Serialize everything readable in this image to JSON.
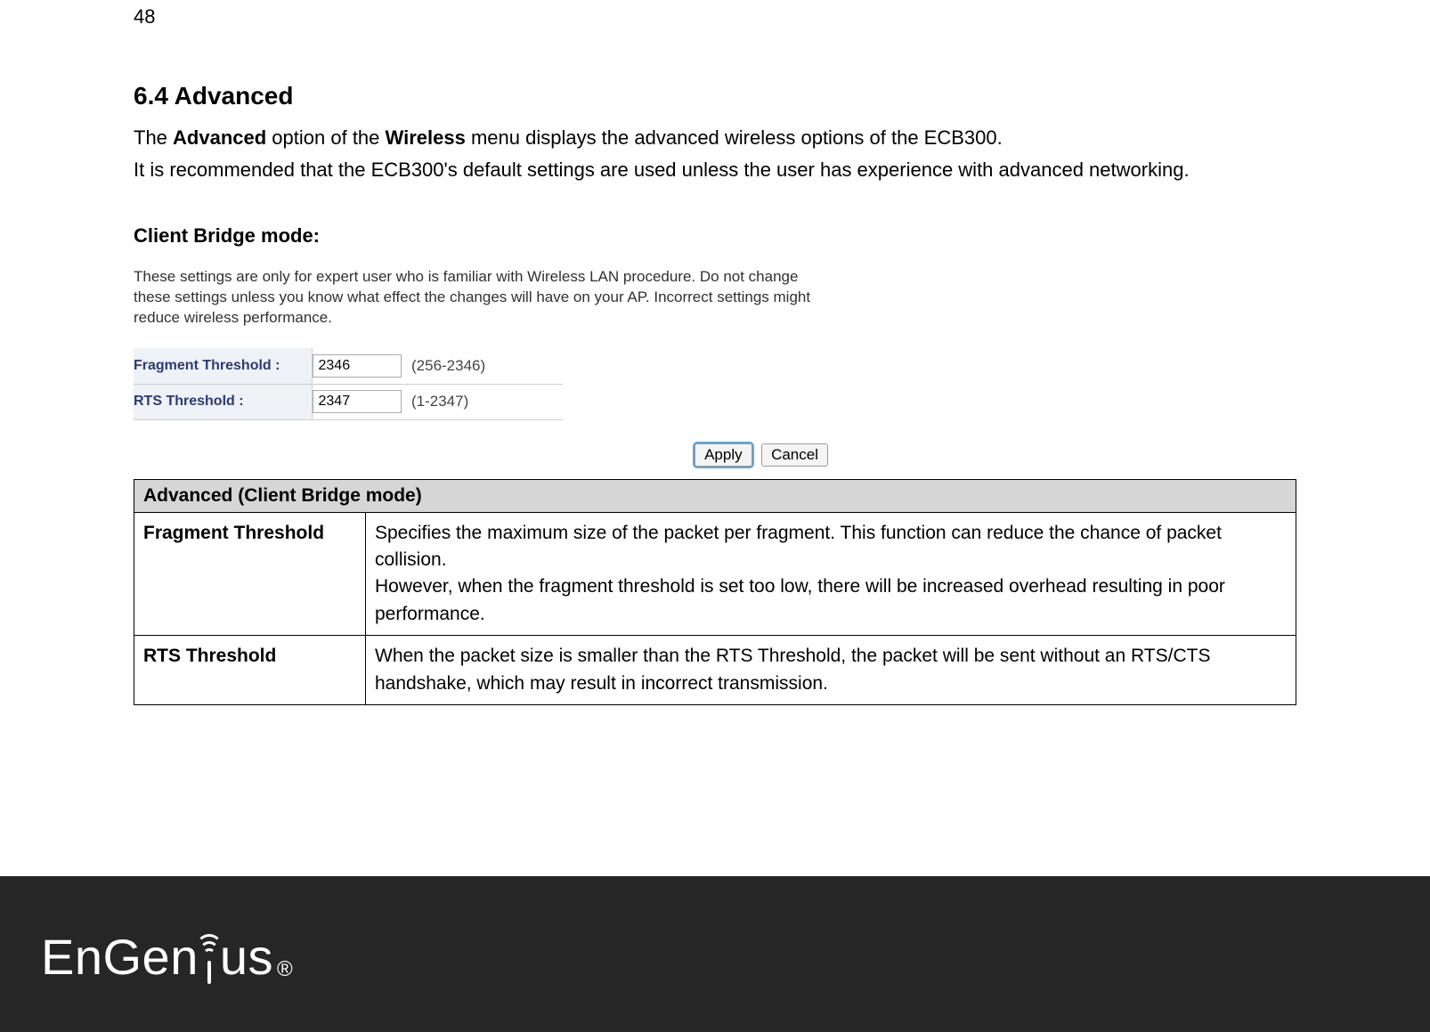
{
  "page_number": "48",
  "heading": "6.4   Advanced",
  "intro": {
    "line1_pre": "The ",
    "line1_bold1": "Advanced",
    "line1_mid": " option of the ",
    "line1_bold2": "Wireless",
    "line1_post": " menu displays the advanced wireless options of the ECB300.",
    "line2": "It is recommended that the ECB300's default settings are used unless the user has experience with advanced networking."
  },
  "subheading": "Client Bridge mode:",
  "warning": "These settings are only for expert user who is familiar with Wireless LAN procedure. Do not change these settings unless you know what effect the changes will have on your AP. Incorrect settings might reduce wireless performance.",
  "settings": {
    "rows": [
      {
        "label": "Fragment Threshold :",
        "value": "2346",
        "range": "(256-2346)"
      },
      {
        "label": "RTS Threshold :",
        "value": "2347",
        "range": "(1-2347)"
      }
    ],
    "apply": "Apply",
    "cancel": "Cancel"
  },
  "desc_table": {
    "header": "Advanced (Client Bridge mode)",
    "rows": [
      {
        "key": "Fragment Threshold",
        "val": "Specifies the maximum size of the packet per fragment. This function can reduce the chance of packet collision.\nHowever, when the fragment threshold is set too low, there will be increased overhead resulting in poor performance."
      },
      {
        "key": "RTS Threshold",
        "val": "When the packet size is smaller than the RTS Threshold, the packet will be sent without an RTS/CTS handshake, which may result in incorrect transmission."
      }
    ]
  },
  "footer": {
    "brand_pre": "EnGen",
    "brand_post": "us",
    "reg": "®"
  }
}
